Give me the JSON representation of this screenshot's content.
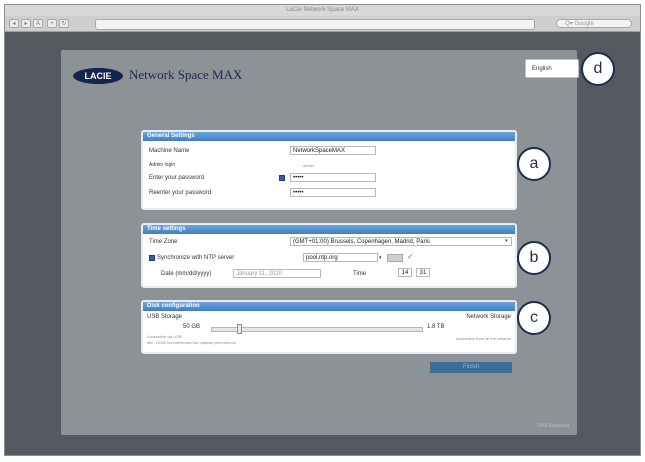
{
  "window": {
    "title": "LaCie Network Space MAX",
    "search_placeholder": "Q▾ Google"
  },
  "brand": {
    "logo": "LACIE",
    "product": "Network Space MAX"
  },
  "language": {
    "selected": "English"
  },
  "callouts": {
    "a": "a",
    "b": "b",
    "c": "c",
    "d": "d"
  },
  "general": {
    "title": "General Settings",
    "machine_name_label": "Machine Name",
    "machine_name_value": "NetworkSpaceMAX",
    "admin_login_label": "Admin login",
    "admin_login_value": "admin",
    "password_label": "Enter your password",
    "password_value": "•••••",
    "reenter_label": "Reenter your password",
    "reenter_value": "•••••"
  },
  "time": {
    "title": "Time settings",
    "timezone_label": "Time Zone",
    "timezone_value": "(GMT+01:00) Brussels, Copenhagen, Madrid, Paris",
    "ntp_label": "Synchronize with NTP server",
    "ntp_server": "pool.ntp.org",
    "date_label": "Date (mm/dd/yyyy)",
    "date_value": "January 11, 2010",
    "time_label": "Time",
    "hour": "14",
    "minute": "31"
  },
  "disk": {
    "title": "Disk configuration",
    "usb_label": "USB Storage",
    "network_label": "Network Storage",
    "usb_size": "50 GB",
    "network_size": "1.8 TB",
    "slider_fraction": 0.12,
    "hint_left": "Accessible via USB",
    "hint_left2": "Min. 10GB recommended for optimal performance",
    "hint_right": "Accessible from all the network"
  },
  "actions": {
    "finish": "Finish"
  },
  "footer": {
    "note": "NAS Assistant"
  },
  "colors": {
    "accent": "#3f7fc2",
    "callout": "#1e2c4f"
  }
}
